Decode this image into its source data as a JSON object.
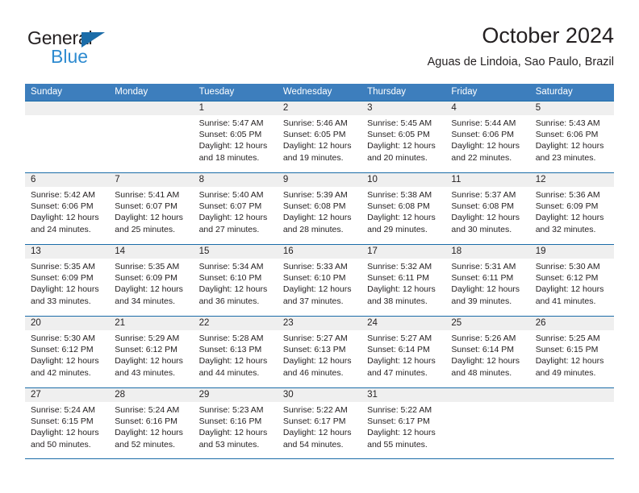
{
  "brand": {
    "name_part1": "General",
    "name_part2": "Blue"
  },
  "header": {
    "month_title": "October 2024",
    "location": "Aguas de Lindoia, Sao Paulo, Brazil"
  },
  "colors": {
    "header_blue": "#3d7ebd",
    "rule_blue": "#1b6ca8",
    "band_gray": "#efefef",
    "brand_blue": "#2e8bd0",
    "text": "#231f20"
  },
  "weekdays": [
    "Sunday",
    "Monday",
    "Tuesday",
    "Wednesday",
    "Thursday",
    "Friday",
    "Saturday"
  ],
  "weeks": [
    [
      {
        "day": "",
        "lines": []
      },
      {
        "day": "",
        "lines": []
      },
      {
        "day": "1",
        "lines": [
          "Sunrise: 5:47 AM",
          "Sunset: 6:05 PM",
          "Daylight: 12 hours",
          "and 18 minutes."
        ]
      },
      {
        "day": "2",
        "lines": [
          "Sunrise: 5:46 AM",
          "Sunset: 6:05 PM",
          "Daylight: 12 hours",
          "and 19 minutes."
        ]
      },
      {
        "day": "3",
        "lines": [
          "Sunrise: 5:45 AM",
          "Sunset: 6:05 PM",
          "Daylight: 12 hours",
          "and 20 minutes."
        ]
      },
      {
        "day": "4",
        "lines": [
          "Sunrise: 5:44 AM",
          "Sunset: 6:06 PM",
          "Daylight: 12 hours",
          "and 22 minutes."
        ]
      },
      {
        "day": "5",
        "lines": [
          "Sunrise: 5:43 AM",
          "Sunset: 6:06 PM",
          "Daylight: 12 hours",
          "and 23 minutes."
        ]
      }
    ],
    [
      {
        "day": "6",
        "lines": [
          "Sunrise: 5:42 AM",
          "Sunset: 6:06 PM",
          "Daylight: 12 hours",
          "and 24 minutes."
        ]
      },
      {
        "day": "7",
        "lines": [
          "Sunrise: 5:41 AM",
          "Sunset: 6:07 PM",
          "Daylight: 12 hours",
          "and 25 minutes."
        ]
      },
      {
        "day": "8",
        "lines": [
          "Sunrise: 5:40 AM",
          "Sunset: 6:07 PM",
          "Daylight: 12 hours",
          "and 27 minutes."
        ]
      },
      {
        "day": "9",
        "lines": [
          "Sunrise: 5:39 AM",
          "Sunset: 6:08 PM",
          "Daylight: 12 hours",
          "and 28 minutes."
        ]
      },
      {
        "day": "10",
        "lines": [
          "Sunrise: 5:38 AM",
          "Sunset: 6:08 PM",
          "Daylight: 12 hours",
          "and 29 minutes."
        ]
      },
      {
        "day": "11",
        "lines": [
          "Sunrise: 5:37 AM",
          "Sunset: 6:08 PM",
          "Daylight: 12 hours",
          "and 30 minutes."
        ]
      },
      {
        "day": "12",
        "lines": [
          "Sunrise: 5:36 AM",
          "Sunset: 6:09 PM",
          "Daylight: 12 hours",
          "and 32 minutes."
        ]
      }
    ],
    [
      {
        "day": "13",
        "lines": [
          "Sunrise: 5:35 AM",
          "Sunset: 6:09 PM",
          "Daylight: 12 hours",
          "and 33 minutes."
        ]
      },
      {
        "day": "14",
        "lines": [
          "Sunrise: 5:35 AM",
          "Sunset: 6:09 PM",
          "Daylight: 12 hours",
          "and 34 minutes."
        ]
      },
      {
        "day": "15",
        "lines": [
          "Sunrise: 5:34 AM",
          "Sunset: 6:10 PM",
          "Daylight: 12 hours",
          "and 36 minutes."
        ]
      },
      {
        "day": "16",
        "lines": [
          "Sunrise: 5:33 AM",
          "Sunset: 6:10 PM",
          "Daylight: 12 hours",
          "and 37 minutes."
        ]
      },
      {
        "day": "17",
        "lines": [
          "Sunrise: 5:32 AM",
          "Sunset: 6:11 PM",
          "Daylight: 12 hours",
          "and 38 minutes."
        ]
      },
      {
        "day": "18",
        "lines": [
          "Sunrise: 5:31 AM",
          "Sunset: 6:11 PM",
          "Daylight: 12 hours",
          "and 39 minutes."
        ]
      },
      {
        "day": "19",
        "lines": [
          "Sunrise: 5:30 AM",
          "Sunset: 6:12 PM",
          "Daylight: 12 hours",
          "and 41 minutes."
        ]
      }
    ],
    [
      {
        "day": "20",
        "lines": [
          "Sunrise: 5:30 AM",
          "Sunset: 6:12 PM",
          "Daylight: 12 hours",
          "and 42 minutes."
        ]
      },
      {
        "day": "21",
        "lines": [
          "Sunrise: 5:29 AM",
          "Sunset: 6:12 PM",
          "Daylight: 12 hours",
          "and 43 minutes."
        ]
      },
      {
        "day": "22",
        "lines": [
          "Sunrise: 5:28 AM",
          "Sunset: 6:13 PM",
          "Daylight: 12 hours",
          "and 44 minutes."
        ]
      },
      {
        "day": "23",
        "lines": [
          "Sunrise: 5:27 AM",
          "Sunset: 6:13 PM",
          "Daylight: 12 hours",
          "and 46 minutes."
        ]
      },
      {
        "day": "24",
        "lines": [
          "Sunrise: 5:27 AM",
          "Sunset: 6:14 PM",
          "Daylight: 12 hours",
          "and 47 minutes."
        ]
      },
      {
        "day": "25",
        "lines": [
          "Sunrise: 5:26 AM",
          "Sunset: 6:14 PM",
          "Daylight: 12 hours",
          "and 48 minutes."
        ]
      },
      {
        "day": "26",
        "lines": [
          "Sunrise: 5:25 AM",
          "Sunset: 6:15 PM",
          "Daylight: 12 hours",
          "and 49 minutes."
        ]
      }
    ],
    [
      {
        "day": "27",
        "lines": [
          "Sunrise: 5:24 AM",
          "Sunset: 6:15 PM",
          "Daylight: 12 hours",
          "and 50 minutes."
        ]
      },
      {
        "day": "28",
        "lines": [
          "Sunrise: 5:24 AM",
          "Sunset: 6:16 PM",
          "Daylight: 12 hours",
          "and 52 minutes."
        ]
      },
      {
        "day": "29",
        "lines": [
          "Sunrise: 5:23 AM",
          "Sunset: 6:16 PM",
          "Daylight: 12 hours",
          "and 53 minutes."
        ]
      },
      {
        "day": "30",
        "lines": [
          "Sunrise: 5:22 AM",
          "Sunset: 6:17 PM",
          "Daylight: 12 hours",
          "and 54 minutes."
        ]
      },
      {
        "day": "31",
        "lines": [
          "Sunrise: 5:22 AM",
          "Sunset: 6:17 PM",
          "Daylight: 12 hours",
          "and 55 minutes."
        ]
      },
      {
        "day": "",
        "lines": []
      },
      {
        "day": "",
        "lines": []
      }
    ]
  ]
}
